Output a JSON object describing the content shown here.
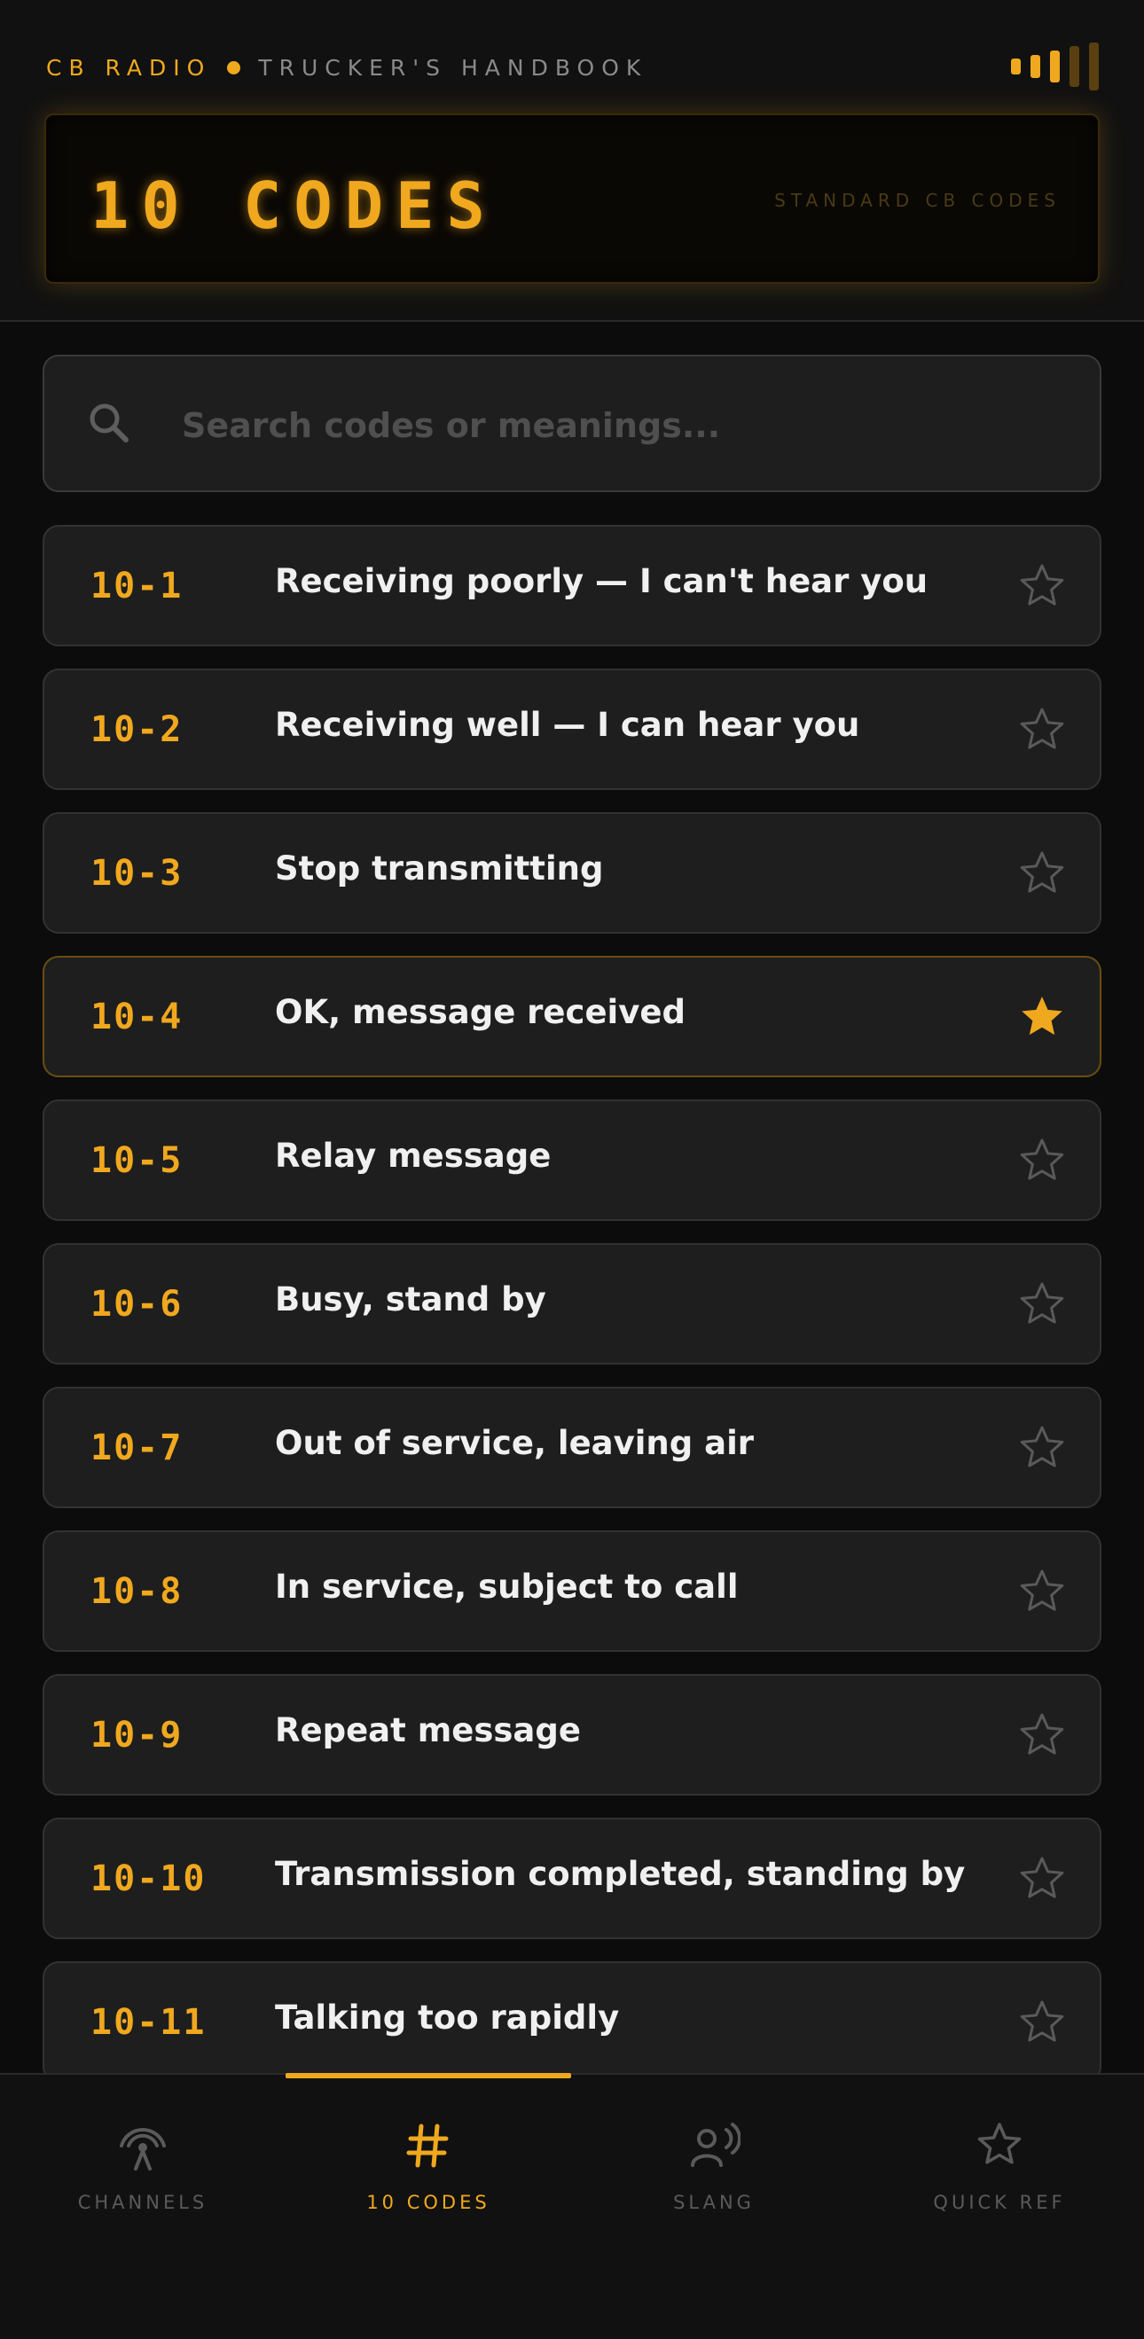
{
  "header": {
    "brand": "CB RADIO",
    "subtitle": "TRUCKER'S HANDBOOK",
    "display_title": "10 CODES",
    "display_subtitle": "STANDARD CB CODES"
  },
  "search": {
    "placeholder": "Search codes or meanings..."
  },
  "codes": [
    {
      "code": "10-1",
      "meaning": "Receiving poorly — I can't hear you",
      "favorite": false
    },
    {
      "code": "10-2",
      "meaning": "Receiving well — I can hear you",
      "favorite": false
    },
    {
      "code": "10-3",
      "meaning": "Stop transmitting",
      "favorite": false
    },
    {
      "code": "10-4",
      "meaning": "OK, message received",
      "favorite": true
    },
    {
      "code": "10-5",
      "meaning": "Relay message",
      "favorite": false
    },
    {
      "code": "10-6",
      "meaning": "Busy, stand by",
      "favorite": false
    },
    {
      "code": "10-7",
      "meaning": "Out of service, leaving air",
      "favorite": false
    },
    {
      "code": "10-8",
      "meaning": "In service, subject to call",
      "favorite": false
    },
    {
      "code": "10-9",
      "meaning": "Repeat message",
      "favorite": false
    },
    {
      "code": "10-10",
      "meaning": "Transmission completed, standing by",
      "favorite": false
    },
    {
      "code": "10-11",
      "meaning": "Talking too rapidly",
      "favorite": false
    }
  ],
  "nav": [
    {
      "label": "CHANNELS",
      "icon": "antenna-icon",
      "active": false
    },
    {
      "label": "10 CODES",
      "icon": "hash-icon",
      "active": true
    },
    {
      "label": "SLANG",
      "icon": "speaker-icon",
      "active": false
    },
    {
      "label": "QUICK REF",
      "icon": "star-icon",
      "active": false
    }
  ],
  "colors": {
    "accent": "#f0a81e",
    "background": "#0c0c0c",
    "card": "#1e1e1e",
    "muted": "#5a5a5a"
  }
}
